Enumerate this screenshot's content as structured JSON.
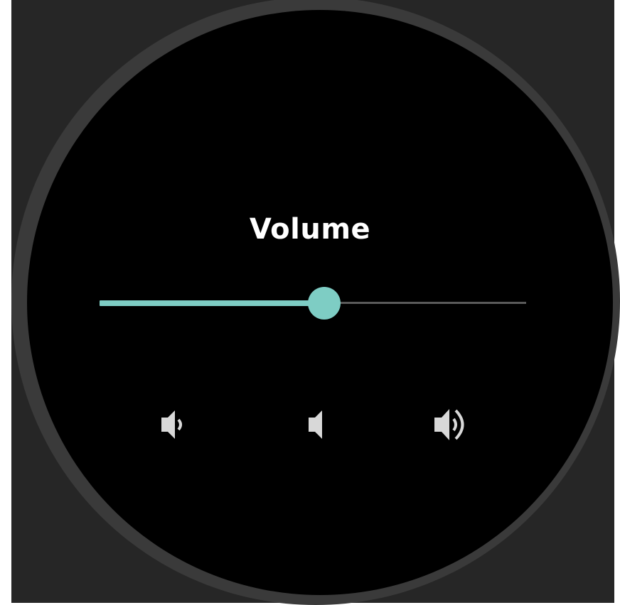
{
  "screen": {
    "title": "Volume"
  },
  "volume_slider": {
    "level_fraction": 0.527,
    "fill_color": "#7ecdc4",
    "track_color": "#5a5a5a"
  },
  "buttons": [
    {
      "name": "volume-down-button",
      "icon": "volume-down-icon"
    },
    {
      "name": "mute-button",
      "icon": "volume-mute-icon"
    },
    {
      "name": "volume-up-button",
      "icon": "volume-up-icon"
    }
  ],
  "colors": {
    "accent": "#7ecdc4",
    "icon": "#d8d8d8",
    "screen_bg": "#000000",
    "bezel": "#3a3a3a"
  }
}
